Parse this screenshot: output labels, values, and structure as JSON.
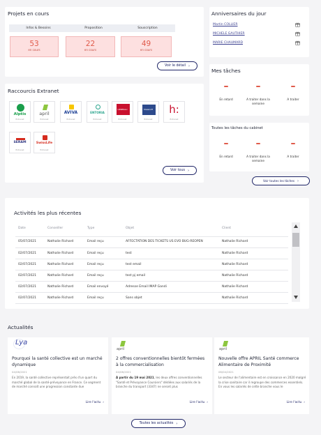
{
  "projets": {
    "title": "Projets en cours",
    "stages": [
      "Infos & Besoins",
      "Proposition",
      "Souscription"
    ],
    "counts": [
      "53",
      "22",
      "49"
    ],
    "count_sub": "en cours",
    "button": "Voir le détail"
  },
  "anniversaires": {
    "title": "Anniversaires du jour",
    "people": [
      "Martin COLLIER",
      "MICHELE GAUTHIER",
      "MARIE CHAUMARD"
    ]
  },
  "mes_taches": {
    "title": "Mes tâches",
    "cols": [
      "En retard",
      "A traiter dans la semaine",
      "A traiter"
    ]
  },
  "cabinet_taches": {
    "title": "Toutes les tâches du cabinet",
    "cols": [
      "En retard",
      "A traiter dans la semaine",
      "A traiter"
    ],
    "button": "Voir toutes les tâches"
  },
  "raccourcis": {
    "title": "Raccourcis Extranet",
    "tiles": [
      {
        "logo": "Alptis",
        "caption": "Extranet",
        "color": "#1a9e4b"
      },
      {
        "logo": "april",
        "caption": "Extranet",
        "color": "#8dc63f"
      },
      {
        "logo": "AVIVA",
        "caption": "Extranet",
        "color": "#1c3f94"
      },
      {
        "logo": "ENTORIA",
        "caption": "Extranet",
        "color": "#2aa48d"
      },
      {
        "logo": "GENERALI",
        "caption": "Extranet",
        "color": "#c8102e"
      },
      {
        "logo": "Malakoff",
        "caption": "Extranet",
        "color": "#2d4a8c"
      },
      {
        "logo": "h:",
        "caption": "Extranet",
        "color": "#c8102e"
      },
      {
        "logo": "SERAM",
        "caption": "Extranet",
        "color": "#2d3580"
      },
      {
        "logo": "SwissLife",
        "caption": "Extranet",
        "color": "#d52b1e"
      }
    ],
    "button": "Voir tous"
  },
  "activites": {
    "title": "Activités les plus récentes",
    "headers": [
      "Date",
      "Conseiller",
      "Type",
      "Objet",
      "Client"
    ],
    "rows": [
      [
        "05/07/2021",
        "Nathalie Richard",
        "Email reçu",
        "AFFECTATION DES TICKETS US EVO BUG-REOPEN",
        "Nathalie Richard"
      ],
      [
        "02/07/2021",
        "Nathalie Richard",
        "Email reçu",
        "test",
        "Nathalie Richard"
      ],
      [
        "02/07/2021",
        "Nathalie Richard",
        "Email reçu",
        "test email",
        "Nathalie Richard"
      ],
      [
        "02/07/2021",
        "Nathalie Richard",
        "Email reçu",
        "test pj email",
        "Nathalie Richard"
      ],
      [
        "02/07/2021",
        "Nathalie Richard",
        "Email envoyé",
        "Adresse Email IMAP Gandi",
        "Nathalie Richard"
      ],
      [
        "02/07/2021",
        "Nathalie Richard",
        "Email reçu",
        "Sans objet",
        "Nathalie Richard"
      ]
    ]
  },
  "actualites": {
    "title": "Actualités",
    "items": [
      {
        "logo": "Lya",
        "title": "Pourquoi la santé collective est un marché dynamique",
        "date": "04/06/2021",
        "text": "En 2019, la santé collective représentait près d'un quart du marché global de la santé-prévoyance en France. Ce segment de marché connaît une progression constante due",
        "link": "Lire l'actu"
      },
      {
        "logo": "april",
        "title": "2 offres conventionnelles bientôt fermées à la commercialisation",
        "date": "04/06/2021",
        "text_bold": "À partir du 19 mai 2021",
        "text": ", les deux offres conventionnelles \"Santé et Prévoyance Coursiers\" dédiées aux salariés de la branche du transport (3347) ne seront plus",
        "link": "Lire l'actu"
      },
      {
        "logo": "april",
        "title": "Nouvelle offre APRIL Santé commerce Alimentaire de Proximité",
        "date": "06/04/2021",
        "text": "Le secteur de l'alimentaire est en croissance en 2020 malgré la crise sanitaire car il regroupe des commerces essentiels. En vous les salariés de cette branche vous le",
        "link": "Lire l'actu"
      }
    ],
    "button": "Toutes les actualités"
  }
}
